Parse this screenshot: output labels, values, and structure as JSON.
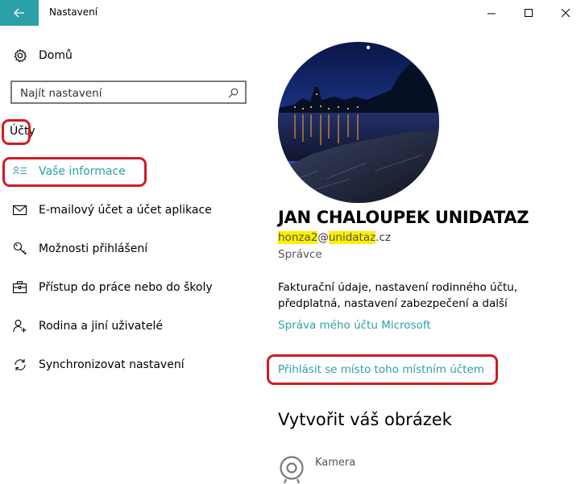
{
  "window": {
    "title": "Nastavení"
  },
  "sidebar": {
    "home_label": "Domů",
    "search_placeholder": "Najít nastavení",
    "section_title": "Účty",
    "items": [
      {
        "label": "Vaše informace",
        "icon": "contact-card-icon",
        "active": true
      },
      {
        "label": "E-mailový účet a účet aplikace",
        "icon": "mail-icon",
        "active": false
      },
      {
        "label": "Možnosti přihlášení",
        "icon": "key-icon",
        "active": false
      },
      {
        "label": "Přístup do práce nebo do školy",
        "icon": "briefcase-icon",
        "active": false
      },
      {
        "label": "Rodina a jiní uživatelé",
        "icon": "person-add-icon",
        "active": false
      },
      {
        "label": "Synchronizovat nastavení",
        "icon": "sync-icon",
        "active": false
      }
    ]
  },
  "main": {
    "user_name": "JAN CHALOUPEK UNIDATAZ",
    "email": {
      "part1": "honza2",
      "part2": "@",
      "part3": "unidataz",
      "part4": ".cz"
    },
    "role": "Správce",
    "description": "Fakturační údaje, nastavení rodinného účtu, předplatná, nastavení zabezpečení a další",
    "manage_link": "Správa mého účtu Microsoft",
    "local_account_link": "Přihlásit se místo toho místním účtem",
    "create_picture_heading": "Vytvořit váš obrázek",
    "camera_label": "Kamera"
  },
  "colors": {
    "accent": "#2aa1a8",
    "annotation": "#d01c25",
    "highlight": "#ffee00"
  }
}
